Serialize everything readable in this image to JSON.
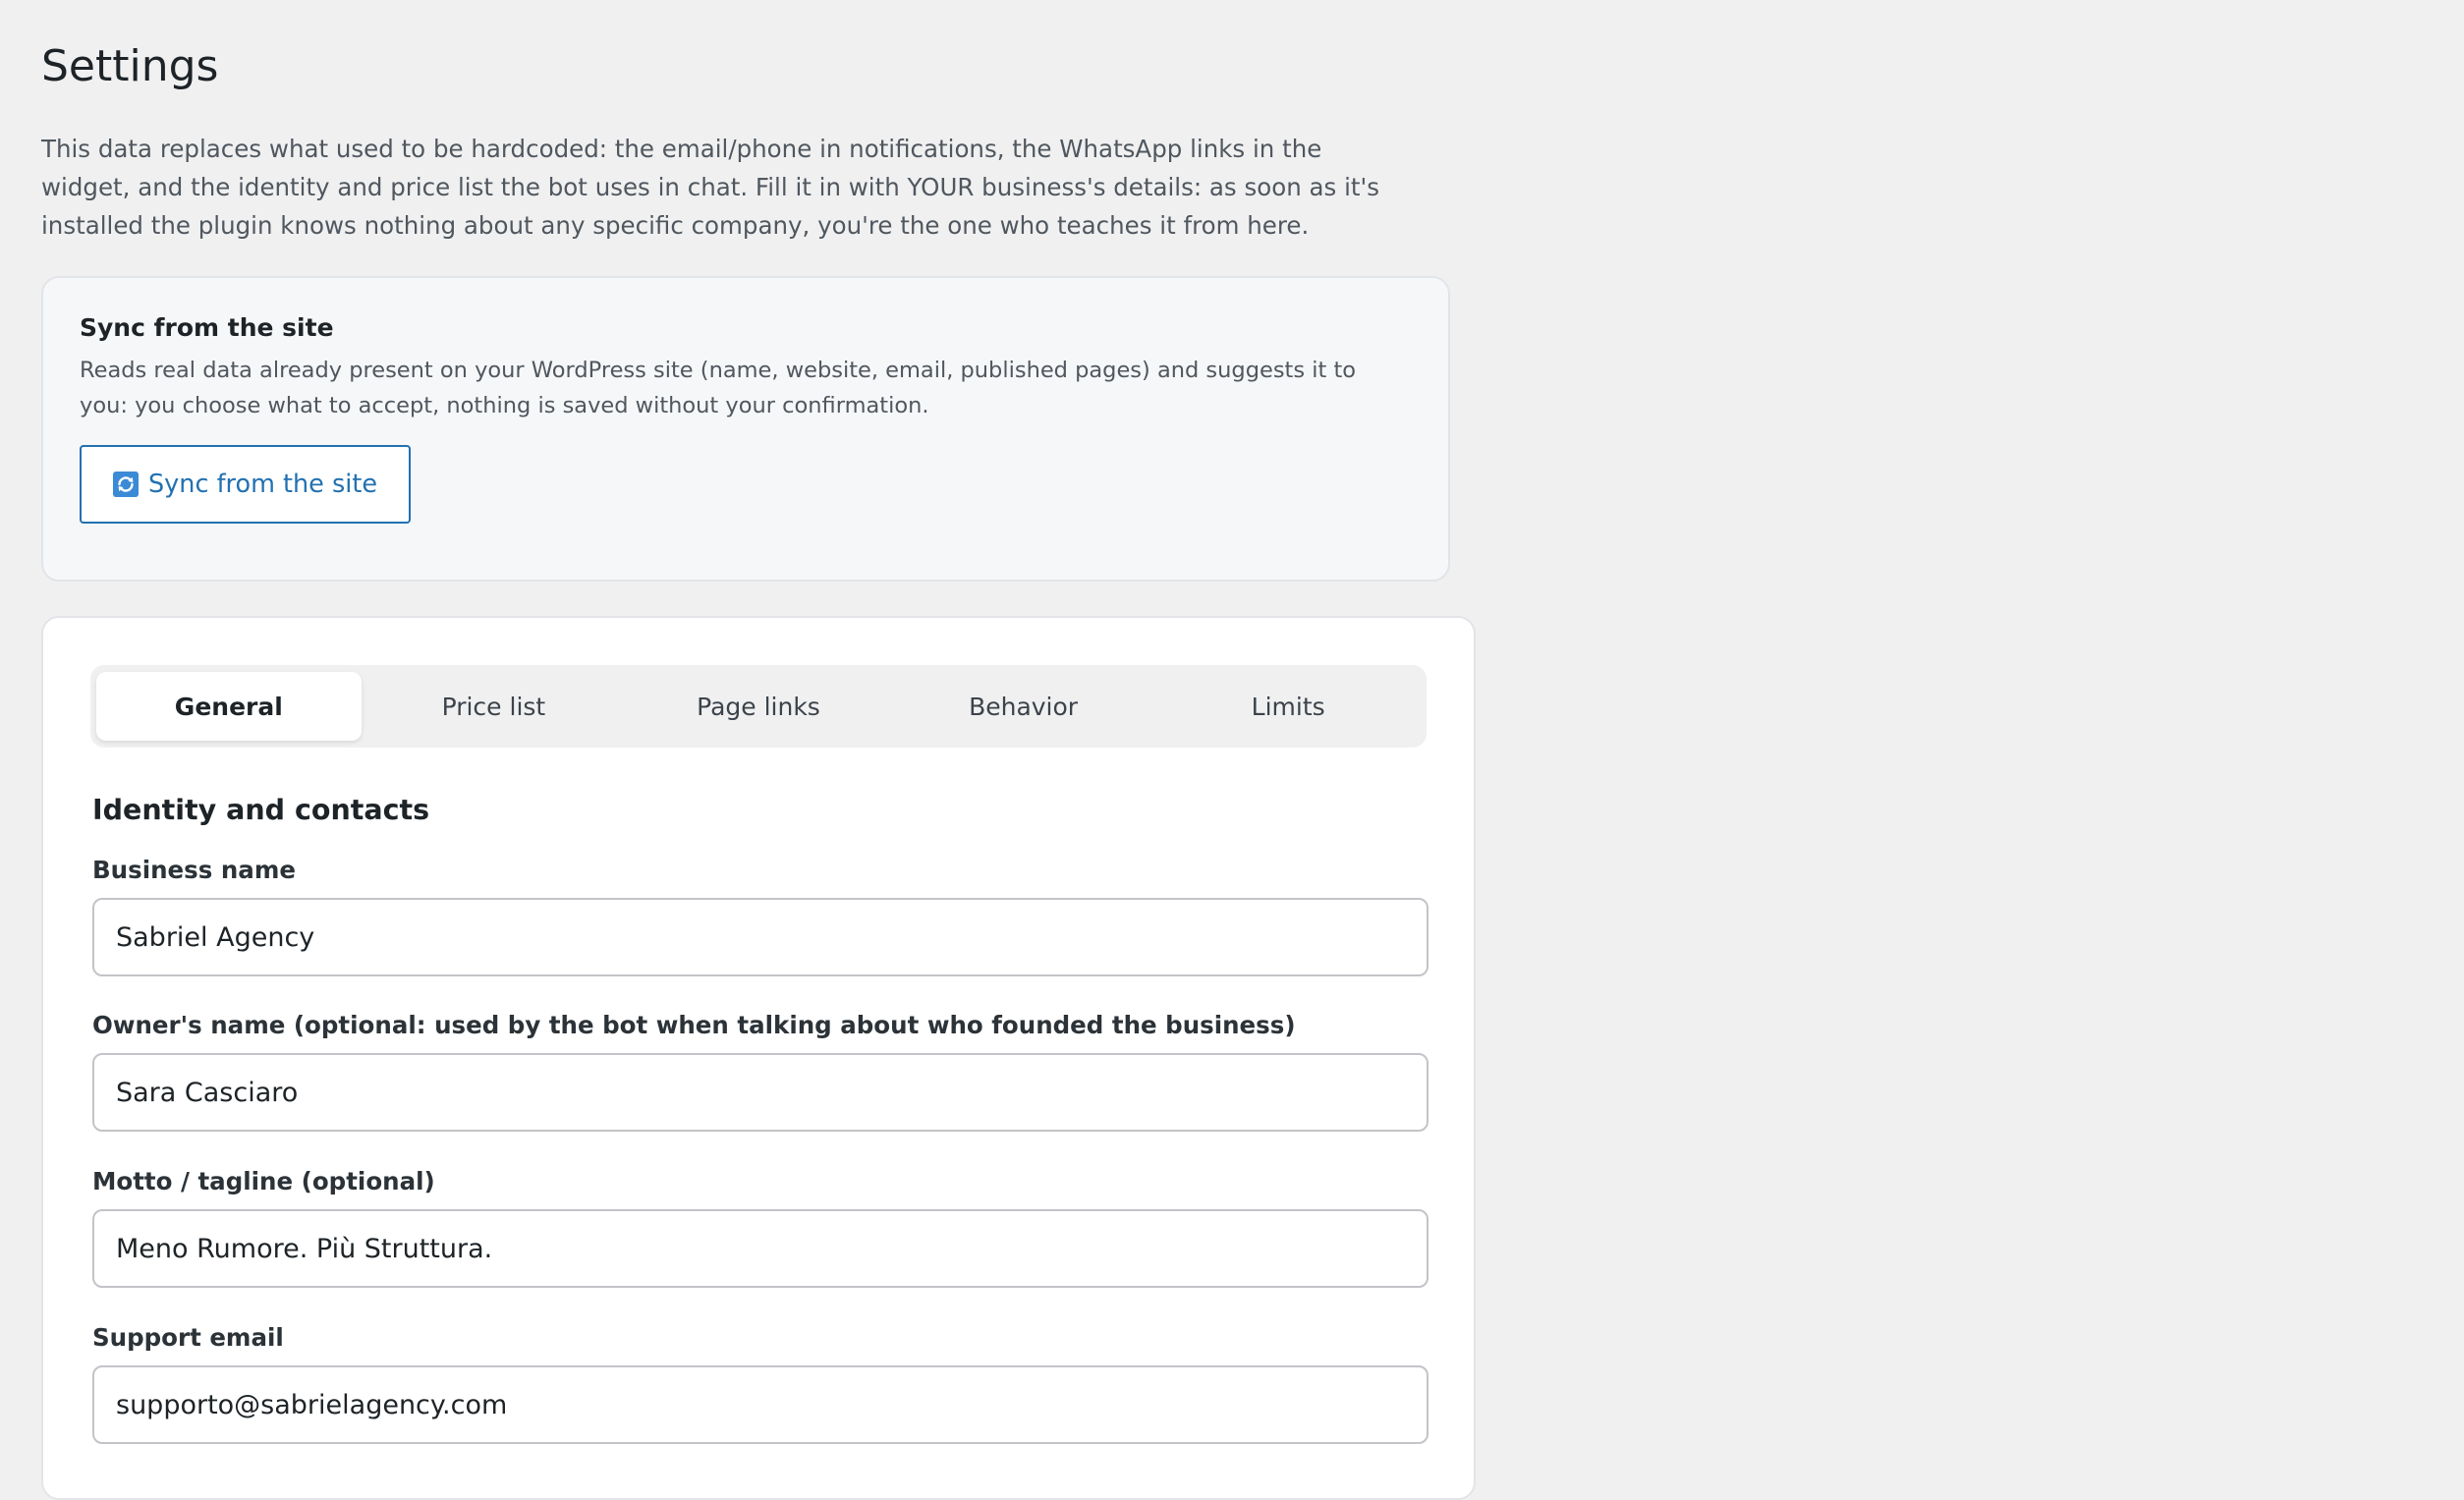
{
  "page": {
    "title": "Settings",
    "intro": "This data replaces what used to be hardcoded: the email/phone in notifications, the WhatsApp links in the widget, and the identity and price list the bot uses in chat. Fill it in with YOUR business's details: as soon as it's installed the plugin knows nothing about any specific company, you're the one who teaches it from here."
  },
  "sync": {
    "title": "Sync from the site",
    "description": "Reads real data already present on your WordPress site (name, website, email, published pages) and suggests it to you: you choose what to accept, nothing is saved without your confirmation.",
    "button_label": "Sync from the site",
    "button_icon": "sync-icon"
  },
  "tabs": [
    {
      "label": "General",
      "active": true
    },
    {
      "label": "Price list",
      "active": false
    },
    {
      "label": "Page links",
      "active": false
    },
    {
      "label": "Behavior",
      "active": false
    },
    {
      "label": "Limits",
      "active": false
    }
  ],
  "general": {
    "section_title": "Identity and contacts",
    "fields": [
      {
        "label": "Business name",
        "value": "Sabriel Agency"
      },
      {
        "label": "Owner's name (optional: used by the bot when talking about who founded the business)",
        "value": "Sara Casciaro"
      },
      {
        "label": "Motto / tagline (optional)",
        "value": "Meno Rumore. Più Struttura."
      },
      {
        "label": "Support email",
        "value": "supporto@sabrielagency.com"
      }
    ]
  },
  "colors": {
    "accent": "#2271b1",
    "background": "#f0f0f1",
    "card": "#ffffff",
    "sync_card": "#f6f7f9"
  }
}
